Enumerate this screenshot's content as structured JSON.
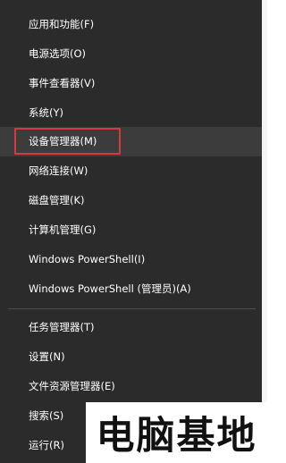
{
  "menu": {
    "items": [
      {
        "label": "应用和功能(F)"
      },
      {
        "label": "电源选项(O)"
      },
      {
        "label": "事件查看器(V)"
      },
      {
        "label": "系统(Y)"
      },
      {
        "label": "设备管理器(M)"
      },
      {
        "label": "网络连接(W)"
      },
      {
        "label": "磁盘管理(K)"
      },
      {
        "label": "计算机管理(G)"
      },
      {
        "label": "Windows PowerShell(I)"
      },
      {
        "label": "Windows PowerShell (管理员)(A)"
      },
      {
        "label": "任务管理器(T)"
      },
      {
        "label": "设置(N)"
      },
      {
        "label": "文件资源管理器(E)"
      },
      {
        "label": "搜索(S)"
      },
      {
        "label": "运行(R)"
      }
    ],
    "hovered_item": "设备管理器(M)"
  },
  "watermark": {
    "text": "电脑基地"
  },
  "colors": {
    "menu_background": "#2b2b2b",
    "hover_background": "#3c3c3c",
    "text": "#ffffff",
    "highlight_border": "#d9393c"
  }
}
